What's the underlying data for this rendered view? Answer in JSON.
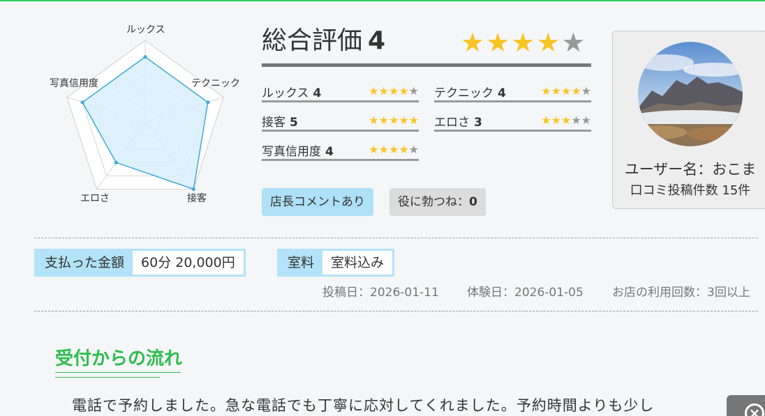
{
  "radar": {
    "labels": [
      "ルックス",
      "テクニック",
      "接客",
      "エロさ",
      "写真信用度"
    ],
    "values": [
      4,
      4,
      5,
      3,
      4
    ],
    "max": 5
  },
  "overall": {
    "title": "総合評価",
    "score": "4",
    "rating": 4,
    "max": 5
  },
  "subratings": [
    {
      "label": "ルックス",
      "score": "4",
      "rating": 4
    },
    {
      "label": "テクニック",
      "score": "4",
      "rating": 4
    },
    {
      "label": "接客",
      "score": "5",
      "rating": 5
    },
    {
      "label": "エロさ",
      "score": "3",
      "rating": 3
    },
    {
      "label": "写真信用度",
      "score": "4",
      "rating": 4
    }
  ],
  "tags": {
    "manager_comment": "店長コメントあり",
    "helpful_label": "役に勃つね：",
    "helpful_count": "0"
  },
  "user": {
    "name": "ユーザー名：おこま",
    "posts": "口コミ投稿件数 15件"
  },
  "payment": {
    "label": "支払った金額",
    "value": "60分 20,000円"
  },
  "room": {
    "label": "室料",
    "value": "室料込み"
  },
  "meta": {
    "posted": "投稿日：2026-01-11",
    "experienced": "体験日：2026-01-05",
    "visits": "お店の利用回数：3回以上"
  },
  "section": {
    "title": "受付からの流れ",
    "text": "電話で予約しました。急な電話でも丁寧に応対してくれました。予約時間よりも少し"
  },
  "colors": {
    "accent_green": "#2dbd4e",
    "star_on": "#f9c525",
    "star_off": "#999999",
    "tag_blue": "#aee0f7",
    "radar_fill": "#d8effb",
    "radar_stroke": "#3fa9d6"
  },
  "icons": {
    "star": "star-icon",
    "close": "close-circle-icon"
  }
}
